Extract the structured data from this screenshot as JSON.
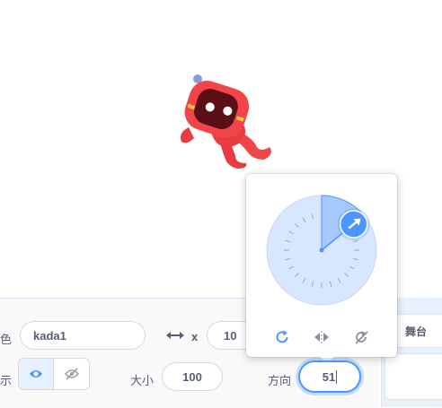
{
  "sprite_info": {
    "sprite_label": "色",
    "sprite_name": "kada1",
    "x_label": "x",
    "x_value": "10",
    "show_label": "示",
    "size_label": "大小",
    "size_value": "100",
    "direction_label": "方向",
    "direction_value": "51"
  },
  "stage_panel": {
    "title": "舞台"
  },
  "direction_popover": {
    "direction_degrees": 51,
    "rotation_modes": [
      "all-around",
      "left-right",
      "dont-rotate"
    ],
    "selected_mode": "all-around"
  },
  "colors": {
    "accent": "#4c97ff",
    "dial_fill": "#d9e6ff",
    "sector_fill": "#a6c8ff",
    "sprite_red": "#f2454a",
    "text": "#575e75"
  },
  "icons": [
    "x-arrows-icon",
    "eye-icon",
    "eye-slash-icon",
    "rotate-all-around-icon",
    "flip-left-right-icon",
    "dont-rotate-icon",
    "direction-handle-arrow-icon"
  ]
}
